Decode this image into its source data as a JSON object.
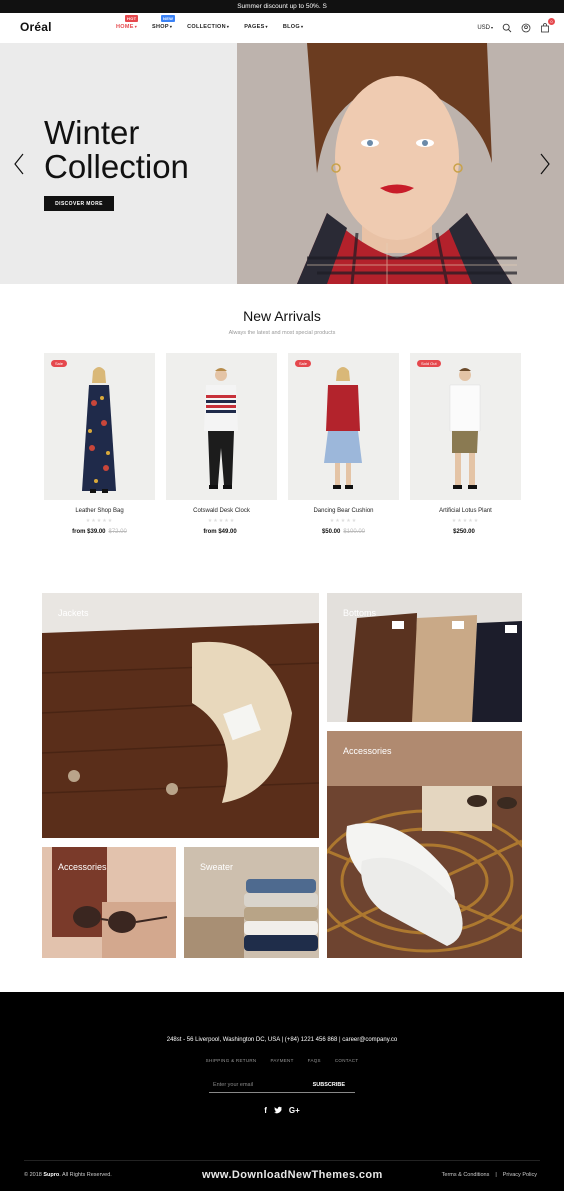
{
  "topbar": {
    "text": "Summer discount up to 50%. S"
  },
  "header": {
    "logo": "Oréal",
    "nav": [
      {
        "label": "HOME",
        "badge": "HOT",
        "active": true
      },
      {
        "label": "SHOP",
        "badge": "NEW",
        "active": false
      },
      {
        "label": "COLLECTION",
        "badge": "",
        "active": false
      },
      {
        "label": "PAGES",
        "badge": "",
        "active": false
      },
      {
        "label": "BLOG",
        "badge": "",
        "active": false
      }
    ],
    "currency": "USD",
    "cart_count": "0"
  },
  "hero": {
    "title_line1": "Winter",
    "title_line2": "Collection",
    "button": "DISCOVER MORE"
  },
  "new_arrivals": {
    "title": "New Arrivals",
    "subtitle": "Always the latest and most special products",
    "products": [
      {
        "name": "Leather Shop Bag",
        "price": "from $39.00",
        "old_price": "$72.00",
        "tag": "Sale"
      },
      {
        "name": "Cotswald Desk Clock",
        "price": "from $49.00",
        "old_price": "",
        "tag": ""
      },
      {
        "name": "Dancing Bear Cushion",
        "price": "$50.00",
        "old_price": "$100.00",
        "tag": "Sale"
      },
      {
        "name": "Artificial Lotus Plant",
        "price": "$250.00",
        "old_price": "",
        "tag": "Sold Out"
      }
    ]
  },
  "categories": {
    "jackets": "Jackets",
    "bottoms": "Bottoms",
    "accessories_large": "Accessories",
    "accessories_small": "Accessories",
    "sweater": "Sweater"
  },
  "footer": {
    "contact": "248st - 56 Liverpool, Washington DC, USA  |  (+84) 1221 456 868  |  career@company.co",
    "links": [
      "SHIPPING & RETURN",
      "PAYMENT",
      "FAQS",
      "CONTACT"
    ],
    "email_placeholder": "Enter your email",
    "subscribe": "SUBSCRIBE",
    "social": [
      "f",
      "t",
      "G+"
    ],
    "copyright_prefix": "© 2018 ",
    "copyright_brand": "Supro",
    "copyright_suffix": ". All Rights Reserved.",
    "watermark": "www.DownloadNewThemes.com",
    "terms": "Terms & Conditions",
    "privacy": "Privacy Policy"
  },
  "colors": {
    "accent": "#e5484d",
    "badge_new": "#3b82f6",
    "footer_bg": "#000000"
  }
}
